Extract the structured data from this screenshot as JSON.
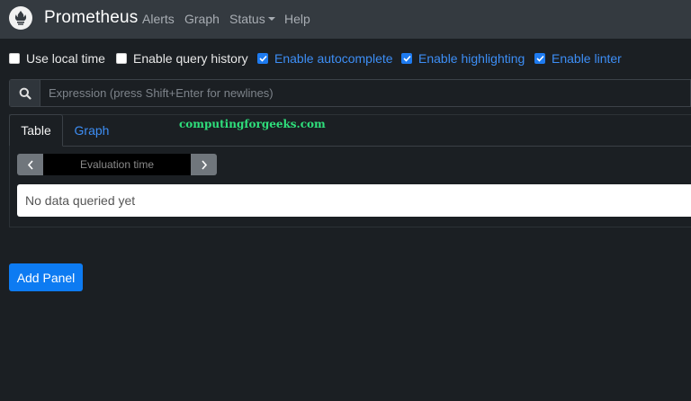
{
  "navbar": {
    "brand": "Prometheus",
    "items": [
      {
        "label": "Alerts"
      },
      {
        "label": "Graph"
      },
      {
        "label": "Status"
      },
      {
        "label": "Help"
      }
    ]
  },
  "options": [
    {
      "label": "Use local time",
      "checked": false
    },
    {
      "label": "Enable query history",
      "checked": false
    },
    {
      "label": "Enable autocomplete",
      "checked": true
    },
    {
      "label": "Enable highlighting",
      "checked": true
    },
    {
      "label": "Enable linter",
      "checked": true
    }
  ],
  "expression": {
    "placeholder": "Expression (press Shift+Enter for newlines)",
    "value": ""
  },
  "tabs": [
    {
      "label": "Table",
      "active": true
    },
    {
      "label": "Graph",
      "active": false
    }
  ],
  "watermark": "computingforgeeks.com",
  "eval": {
    "placeholder": "Evaluation time"
  },
  "table": {
    "empty_message": "No data queried yet"
  },
  "add_panel_label": "Add Panel",
  "colors": {
    "accent": "#0d7bf2",
    "link": "#3d8ef5",
    "navbar": "#343a40",
    "background": "#1b1f23"
  }
}
